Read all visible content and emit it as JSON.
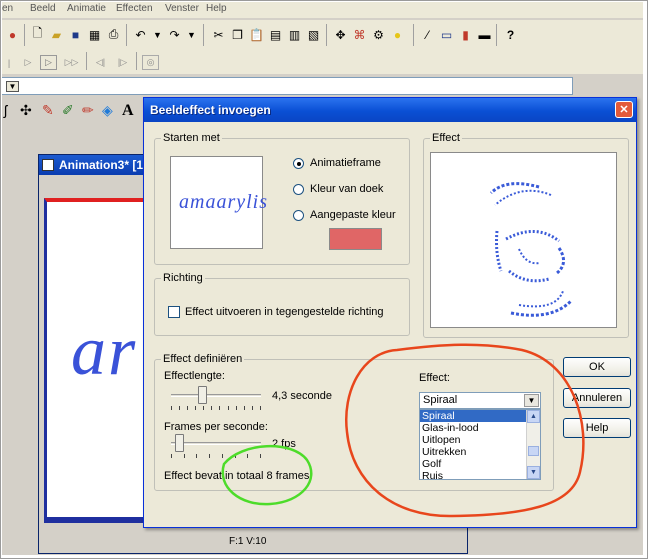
{
  "menubar": {
    "items": [
      "en",
      "Beeld",
      "Animatie",
      "Effecten",
      "Venster",
      "Help"
    ]
  },
  "toolbar_icons": [
    "new-icon",
    "open-icon",
    "save-icon",
    "browse-icon",
    "print-icon",
    "undo-icon",
    "redo-icon",
    "cut-icon",
    "copy-icon",
    "paste-icon",
    "help-pointer-icon"
  ],
  "animation_window": {
    "title": "Animation3* [1",
    "canvas_text": "ar",
    "status": "F:1  V:10"
  },
  "dialog": {
    "title": "Beeldeffect invoegen",
    "start_group": {
      "label": "Starten met",
      "preview_text": "amaarylis",
      "options": [
        "Animatieframe",
        "Kleur van doek",
        "Aangepaste kleur"
      ],
      "selected_index": 0,
      "custom_color": "#e06666"
    },
    "direction_group": {
      "label": "Richting",
      "checkbox_label": "Effect uitvoeren in tegengestelde richting",
      "checked": false
    },
    "effect_preview_group": {
      "label": "Effect"
    },
    "define_group": {
      "label": "Effect definiëren",
      "length_label": "Effectlengte:",
      "length_value": "4,3 seconde",
      "length_fraction": 0.33,
      "fps_label": "Frames per seconde:",
      "fps_value": "2 fps",
      "fps_fraction": 0.05,
      "summary": "Effect bevat in totaal 8 frames.",
      "effect_label": "Effect:",
      "effect_selected": "Spiraal",
      "effect_options": [
        "Spiraal",
        "Glas-in-lood",
        "Uitlopen",
        "Uitrekken",
        "Golf",
        "Ruis"
      ]
    },
    "buttons": {
      "ok": "OK",
      "cancel": "Annuleren",
      "help": "Help"
    }
  },
  "colors": {
    "title_bar": "#0a4fd4",
    "annotation_red": "#e8461c",
    "annotation_green": "#4ddc2a",
    "selection": "#316ac5"
  }
}
